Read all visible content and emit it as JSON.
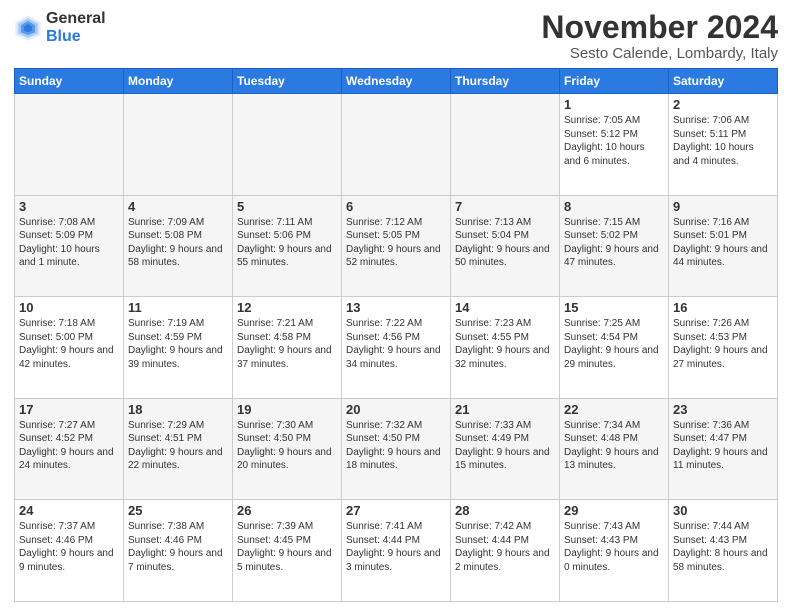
{
  "logo": {
    "general": "General",
    "blue": "Blue"
  },
  "title": "November 2024",
  "subtitle": "Sesto Calende, Lombardy, Italy",
  "days_of_week": [
    "Sunday",
    "Monday",
    "Tuesday",
    "Wednesday",
    "Thursday",
    "Friday",
    "Saturday"
  ],
  "weeks": [
    [
      {
        "day": "",
        "info": ""
      },
      {
        "day": "",
        "info": ""
      },
      {
        "day": "",
        "info": ""
      },
      {
        "day": "",
        "info": ""
      },
      {
        "day": "",
        "info": ""
      },
      {
        "day": "1",
        "info": "Sunrise: 7:05 AM\nSunset: 5:12 PM\nDaylight: 10 hours and 6 minutes."
      },
      {
        "day": "2",
        "info": "Sunrise: 7:06 AM\nSunset: 5:11 PM\nDaylight: 10 hours and 4 minutes."
      }
    ],
    [
      {
        "day": "3",
        "info": "Sunrise: 7:08 AM\nSunset: 5:09 PM\nDaylight: 10 hours and 1 minute."
      },
      {
        "day": "4",
        "info": "Sunrise: 7:09 AM\nSunset: 5:08 PM\nDaylight: 9 hours and 58 minutes."
      },
      {
        "day": "5",
        "info": "Sunrise: 7:11 AM\nSunset: 5:06 PM\nDaylight: 9 hours and 55 minutes."
      },
      {
        "day": "6",
        "info": "Sunrise: 7:12 AM\nSunset: 5:05 PM\nDaylight: 9 hours and 52 minutes."
      },
      {
        "day": "7",
        "info": "Sunrise: 7:13 AM\nSunset: 5:04 PM\nDaylight: 9 hours and 50 minutes."
      },
      {
        "day": "8",
        "info": "Sunrise: 7:15 AM\nSunset: 5:02 PM\nDaylight: 9 hours and 47 minutes."
      },
      {
        "day": "9",
        "info": "Sunrise: 7:16 AM\nSunset: 5:01 PM\nDaylight: 9 hours and 44 minutes."
      }
    ],
    [
      {
        "day": "10",
        "info": "Sunrise: 7:18 AM\nSunset: 5:00 PM\nDaylight: 9 hours and 42 minutes."
      },
      {
        "day": "11",
        "info": "Sunrise: 7:19 AM\nSunset: 4:59 PM\nDaylight: 9 hours and 39 minutes."
      },
      {
        "day": "12",
        "info": "Sunrise: 7:21 AM\nSunset: 4:58 PM\nDaylight: 9 hours and 37 minutes."
      },
      {
        "day": "13",
        "info": "Sunrise: 7:22 AM\nSunset: 4:56 PM\nDaylight: 9 hours and 34 minutes."
      },
      {
        "day": "14",
        "info": "Sunrise: 7:23 AM\nSunset: 4:55 PM\nDaylight: 9 hours and 32 minutes."
      },
      {
        "day": "15",
        "info": "Sunrise: 7:25 AM\nSunset: 4:54 PM\nDaylight: 9 hours and 29 minutes."
      },
      {
        "day": "16",
        "info": "Sunrise: 7:26 AM\nSunset: 4:53 PM\nDaylight: 9 hours and 27 minutes."
      }
    ],
    [
      {
        "day": "17",
        "info": "Sunrise: 7:27 AM\nSunset: 4:52 PM\nDaylight: 9 hours and 24 minutes."
      },
      {
        "day": "18",
        "info": "Sunrise: 7:29 AM\nSunset: 4:51 PM\nDaylight: 9 hours and 22 minutes."
      },
      {
        "day": "19",
        "info": "Sunrise: 7:30 AM\nSunset: 4:50 PM\nDaylight: 9 hours and 20 minutes."
      },
      {
        "day": "20",
        "info": "Sunrise: 7:32 AM\nSunset: 4:50 PM\nDaylight: 9 hours and 18 minutes."
      },
      {
        "day": "21",
        "info": "Sunrise: 7:33 AM\nSunset: 4:49 PM\nDaylight: 9 hours and 15 minutes."
      },
      {
        "day": "22",
        "info": "Sunrise: 7:34 AM\nSunset: 4:48 PM\nDaylight: 9 hours and 13 minutes."
      },
      {
        "day": "23",
        "info": "Sunrise: 7:36 AM\nSunset: 4:47 PM\nDaylight: 9 hours and 11 minutes."
      }
    ],
    [
      {
        "day": "24",
        "info": "Sunrise: 7:37 AM\nSunset: 4:46 PM\nDaylight: 9 hours and 9 minutes."
      },
      {
        "day": "25",
        "info": "Sunrise: 7:38 AM\nSunset: 4:46 PM\nDaylight: 9 hours and 7 minutes."
      },
      {
        "day": "26",
        "info": "Sunrise: 7:39 AM\nSunset: 4:45 PM\nDaylight: 9 hours and 5 minutes."
      },
      {
        "day": "27",
        "info": "Sunrise: 7:41 AM\nSunset: 4:44 PM\nDaylight: 9 hours and 3 minutes."
      },
      {
        "day": "28",
        "info": "Sunrise: 7:42 AM\nSunset: 4:44 PM\nDaylight: 9 hours and 2 minutes."
      },
      {
        "day": "29",
        "info": "Sunrise: 7:43 AM\nSunset: 4:43 PM\nDaylight: 9 hours and 0 minutes."
      },
      {
        "day": "30",
        "info": "Sunrise: 7:44 AM\nSunset: 4:43 PM\nDaylight: 8 hours and 58 minutes."
      }
    ]
  ]
}
